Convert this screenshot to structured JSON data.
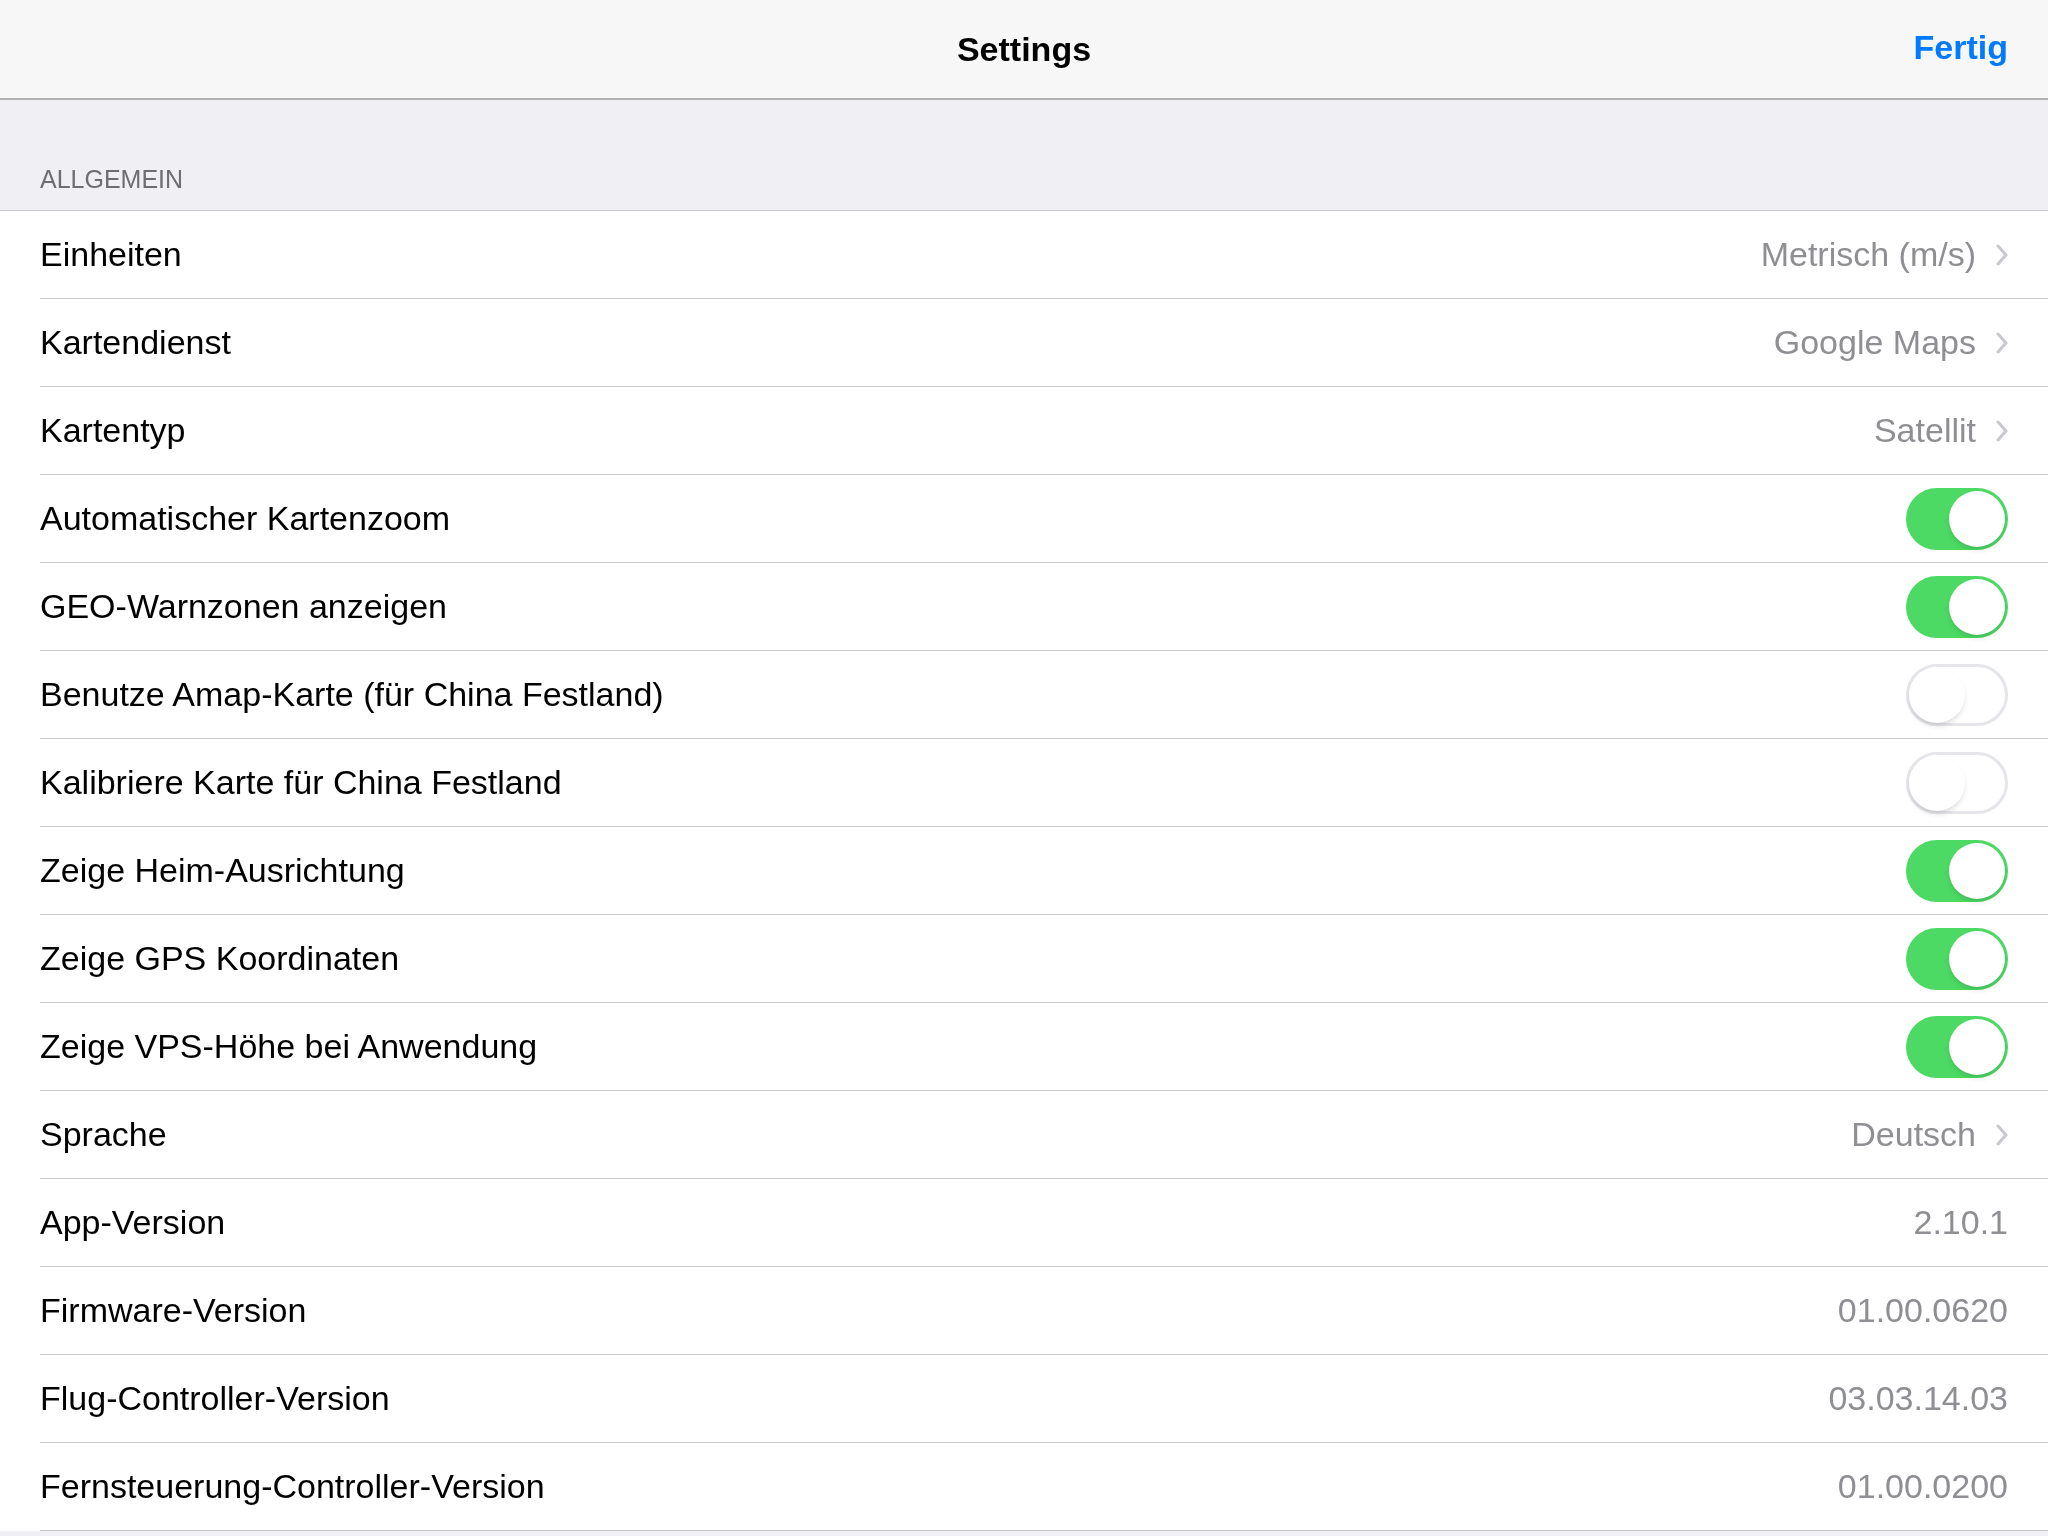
{
  "nav_bar": {
    "title": "Settings",
    "done_button": "Fertig"
  },
  "section": {
    "header": "ALLGEMEIN",
    "rows": [
      {
        "kind": "disclosure",
        "label": "Einheiten",
        "value": "Metrisch (m/s)"
      },
      {
        "kind": "disclosure",
        "label": "Kartendienst",
        "value": "Google Maps"
      },
      {
        "kind": "disclosure",
        "label": "Kartentyp",
        "value": "Satellit"
      },
      {
        "kind": "toggle",
        "label": "Automatischer Kartenzoom",
        "on": true
      },
      {
        "kind": "toggle",
        "label": "GEO-Warnzonen anzeigen",
        "on": true
      },
      {
        "kind": "toggle",
        "label": "Benutze Amap-Karte (für China Festland)",
        "on": false
      },
      {
        "kind": "toggle",
        "label": "Kalibriere Karte für China Festland",
        "on": false
      },
      {
        "kind": "toggle",
        "label": "Zeige Heim-Ausrichtung",
        "on": true
      },
      {
        "kind": "toggle",
        "label": "Zeige GPS Koordinaten",
        "on": true
      },
      {
        "kind": "toggle",
        "label": "Zeige VPS-Höhe bei Anwendung",
        "on": true
      },
      {
        "kind": "disclosure",
        "label": "Sprache",
        "value": "Deutsch"
      },
      {
        "kind": "value",
        "label": "App-Version",
        "value": "2.10.1"
      },
      {
        "kind": "value",
        "label": "Firmware-Version",
        "value": "01.00.0620"
      },
      {
        "kind": "value",
        "label": "Flug-Controller-Version",
        "value": "03.03.14.03"
      },
      {
        "kind": "value",
        "label": "Fernsteuerung-Controller-Version",
        "value": "01.00.0200"
      }
    ]
  }
}
